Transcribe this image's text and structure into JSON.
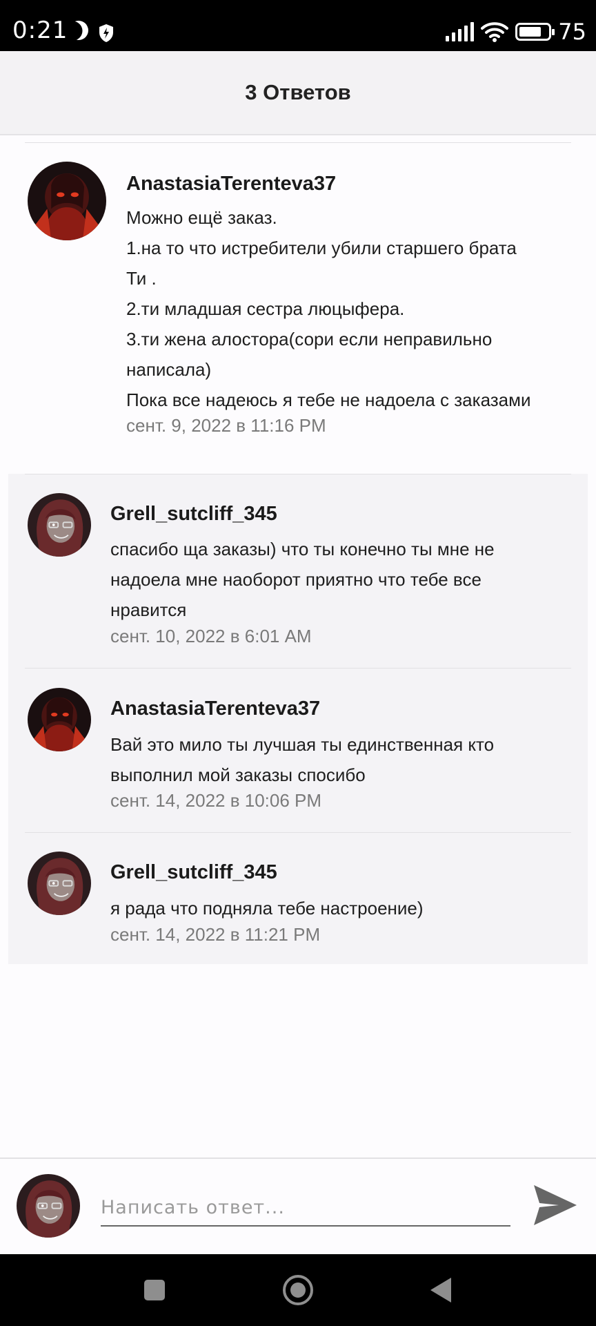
{
  "status_bar": {
    "time": "0:21",
    "battery": "75"
  },
  "header": {
    "title": "3 Ответов"
  },
  "comment": {
    "author": "AnastasiaTerenteva37",
    "lines": [
      "Можно ещё заказ.",
      "1.на то что истребители убили старшего брата",
      "Ти .",
      "2.ти младшая сестра люцыфера.",
      "3.ти жена алостора(сори если неправильно",
      "написала)",
      "Пока все надеюсь я тебе не надоела с заказами"
    ],
    "date": "сент. 9, 2022 в 11:16 PM"
  },
  "replies": [
    {
      "author": "Grell_sutcliff_345",
      "lines": [
        "спасибо ща заказы) что ты конечно ты мне не",
        "надоела мне наоборот приятно что тебе все",
        "нравится"
      ],
      "date": "сент. 10, 2022 в 6:01 AM"
    },
    {
      "author": "AnastasiaTerenteva37",
      "lines": [
        "Вай это мило ты лучшая ты единственная кто",
        "выполнил мой заказы спосибо"
      ],
      "date": "сент. 14, 2022 в 10:06 PM"
    },
    {
      "author": "Grell_sutcliff_345",
      "lines": [
        "я рада что подняла тебе настроение)"
      ],
      "date": "сент. 14, 2022 в 11:21 PM"
    }
  ],
  "reply_box": {
    "placeholder": "Написать ответ..."
  },
  "icons": {
    "send": "send-icon",
    "avatar_anastasia": "red-dark-avatar",
    "avatar_grell": "dark-red-hair-avatar"
  },
  "colors": {
    "header_bg": "#f3f2f4",
    "replies_bg": "#f4f3f6",
    "date_text": "#7a7a7a",
    "send_icon": "#666666"
  }
}
